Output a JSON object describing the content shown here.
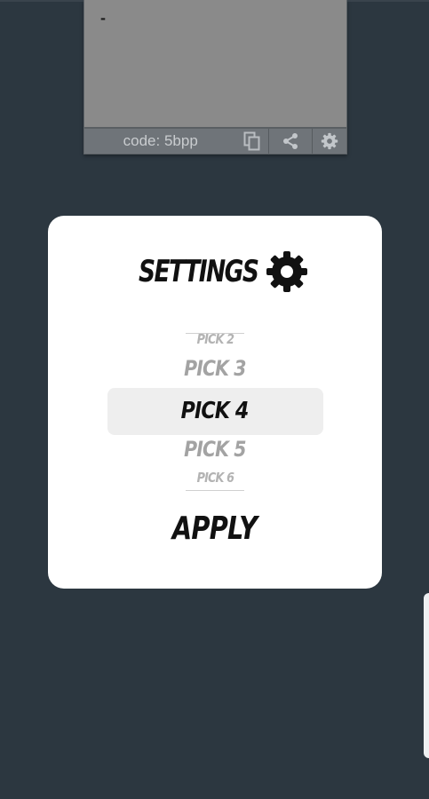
{
  "preview": {
    "text": "-",
    "code_label": "code: 5bpp",
    "icons": {
      "copy": "copy-icon",
      "share": "share-icon",
      "settings": "gear-icon"
    }
  },
  "settings": {
    "title": "SETTINGS",
    "title_icon": "gear-icon",
    "options": [
      "PICK 2",
      "PICK 3",
      "PICK 4",
      "PICK 5",
      "PICK 6"
    ],
    "selected": "PICK 4",
    "apply_label": "APPLY"
  },
  "colors": {
    "background": "#2c3740",
    "modal": "#ffffff",
    "selected_row": "#eeeeee",
    "text_dark": "#111111",
    "text_muted": "#a3a3a3"
  }
}
